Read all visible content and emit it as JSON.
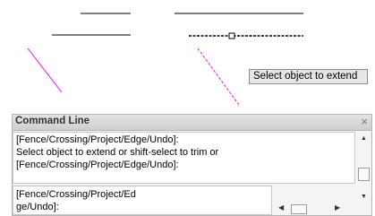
{
  "tooltip": {
    "text": "Select object to extend"
  },
  "command_line": {
    "title": "Command Line",
    "close_glyph": "×",
    "history": [
      "[Fence/Crossing/Project/Edge/Undo]:",
      "Select object to extend or shift-select to trim or",
      "[Fence/Crossing/Project/Edge/Undo]:"
    ],
    "input_lines": [
      "[Fence/Crossing/Project/Ed",
      "ge/Undo]:"
    ]
  },
  "colors": {
    "magenta_line": "#ff00ff",
    "selected_line": "#000000",
    "background": "#ffffff"
  },
  "icons": {
    "scroll_up": "▲",
    "scroll_down": "▼",
    "scroll_left": "◀",
    "scroll_right": "▶"
  }
}
